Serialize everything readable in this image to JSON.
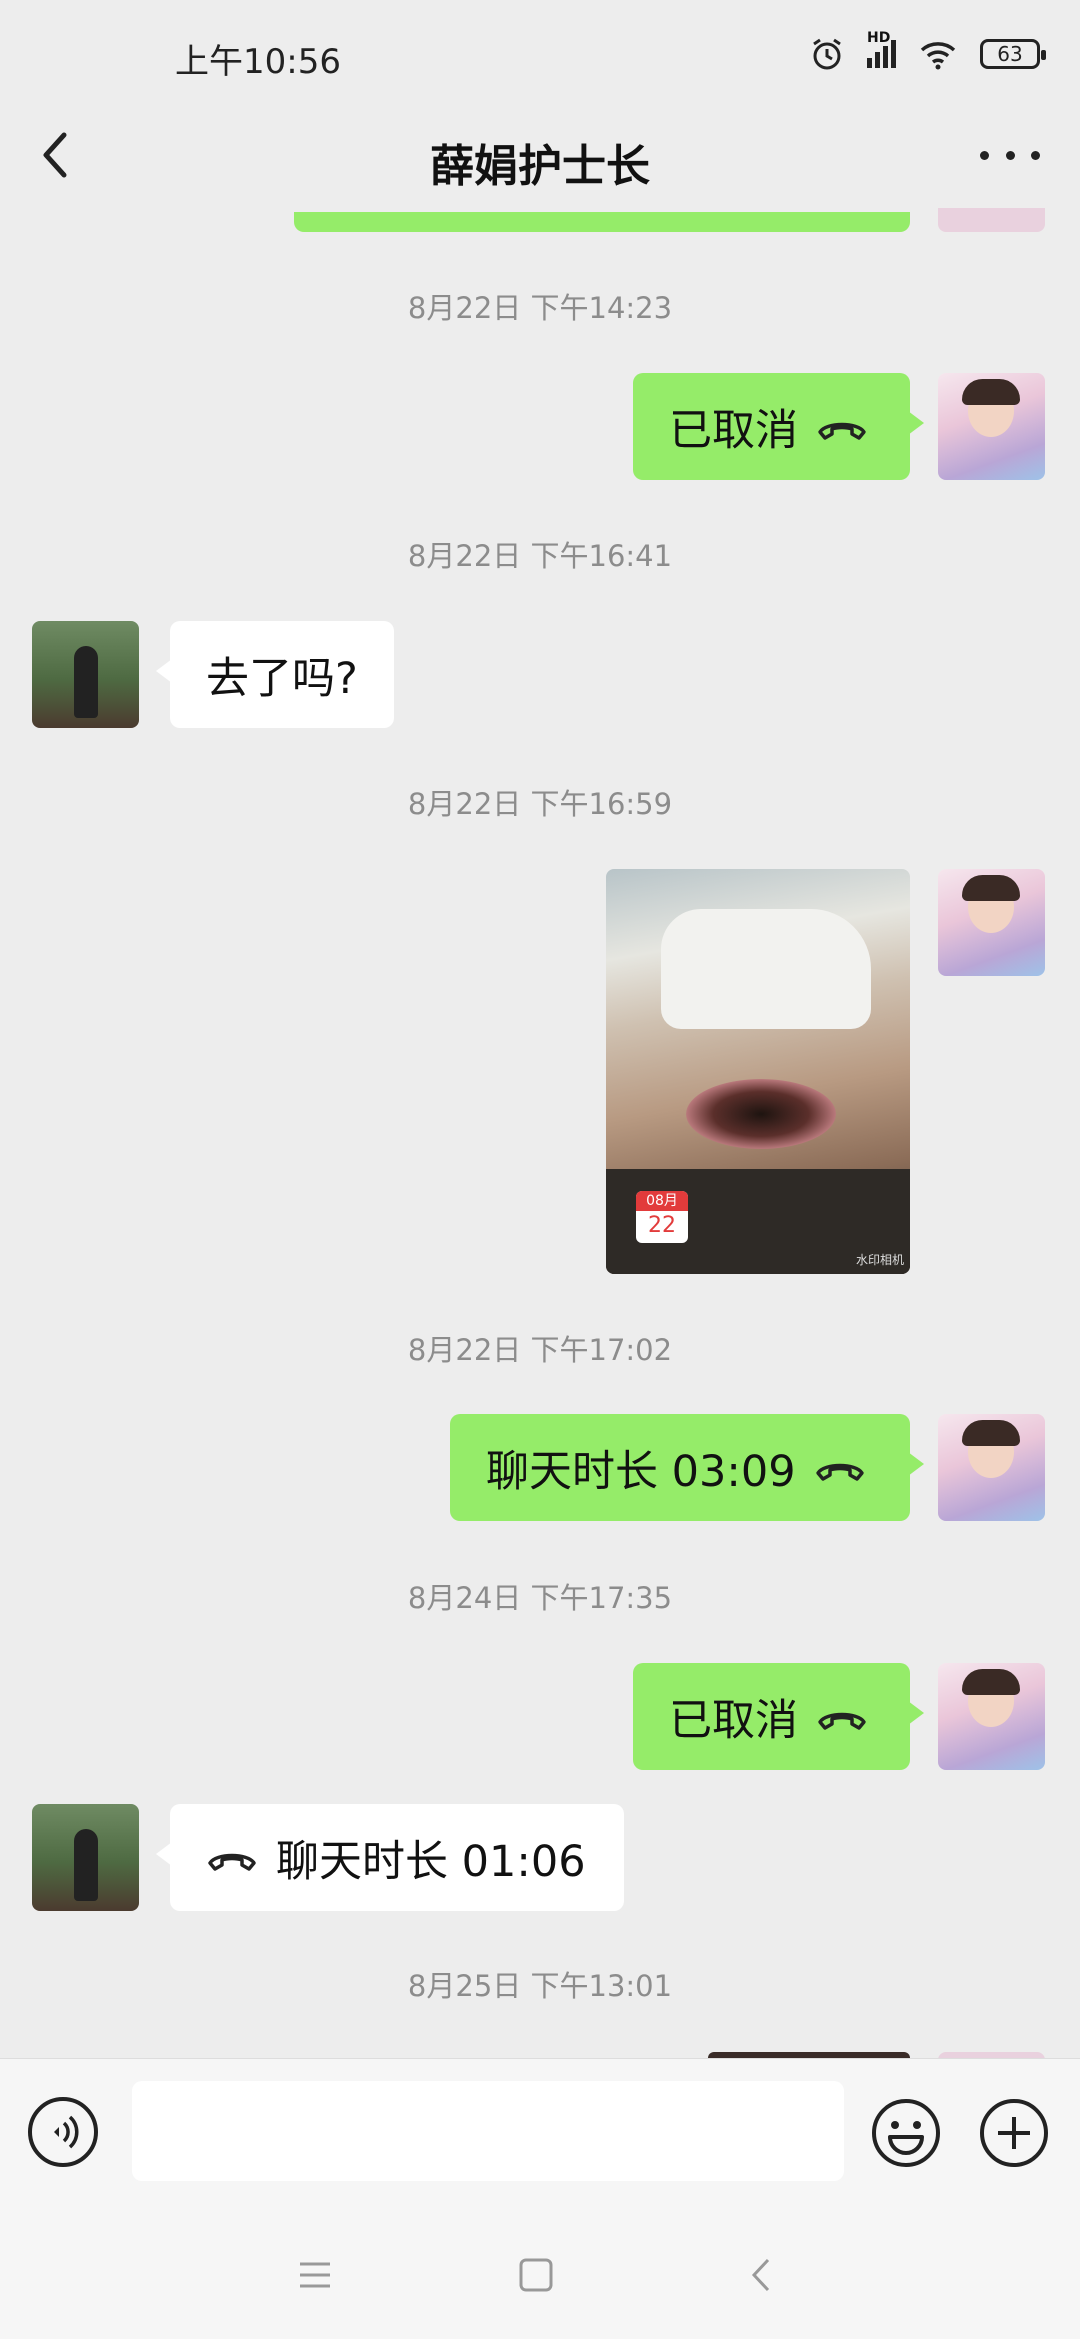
{
  "status_bar": {
    "time": "上午10:56",
    "network": "HD",
    "battery": "63"
  },
  "header": {
    "title": "薛娟护士长"
  },
  "messages": [
    {
      "timestamp": "8月22日 下午14:23",
      "side": "me",
      "type": "call",
      "text": "已取消"
    },
    {
      "timestamp": "8月22日 下午16:41",
      "side": "other",
      "type": "text",
      "text": "去了吗?"
    },
    {
      "timestamp": "8月22日 下午16:59",
      "side": "me",
      "type": "image",
      "calendar_month": "08月",
      "calendar_day": "22",
      "watermark": "水印相机"
    },
    {
      "timestamp": "8月22日 下午17:02",
      "side": "me",
      "type": "call",
      "text": "聊天时长 03:09"
    },
    {
      "timestamp": "8月24日 下午17:35",
      "side": "me",
      "type": "call",
      "text": "已取消"
    },
    {
      "side": "other",
      "type": "call",
      "text": "聊天时长 01:06"
    },
    {
      "timestamp": "8月25日 下午13:01"
    }
  ],
  "input": {
    "placeholder": ""
  },
  "icons": {
    "back": "back-arrow-icon",
    "more": "more-icon",
    "voice": "voice-icon",
    "emoji": "emoji-icon",
    "plus": "plus-icon",
    "call": "phone-hangup-icon"
  },
  "colors": {
    "bubble_me": "#95ec69",
    "bubble_other": "#ffffff",
    "background": "#ededed"
  }
}
